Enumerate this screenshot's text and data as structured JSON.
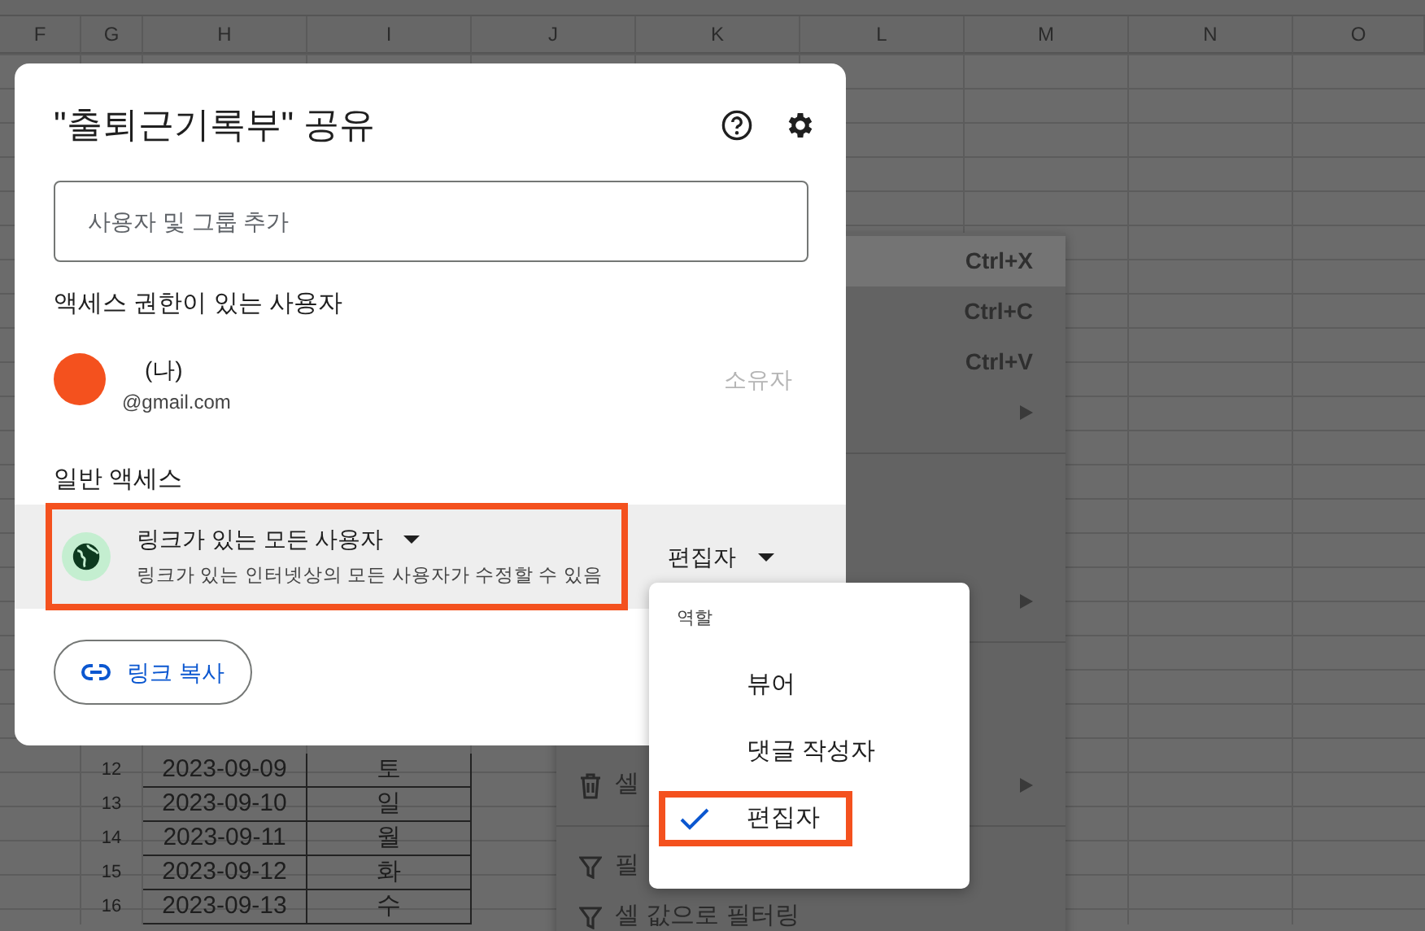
{
  "spreadsheet": {
    "columns": [
      "F",
      "G",
      "H",
      "I",
      "J",
      "K",
      "L",
      "M",
      "N",
      "O"
    ],
    "rows": [
      {
        "cells": [
          "",
          "12",
          "2023-09-09",
          "토"
        ]
      },
      {
        "cells": [
          "",
          "13",
          "2023-09-10",
          "일"
        ]
      },
      {
        "cells": [
          "",
          "14",
          "2023-09-11",
          "월"
        ]
      },
      {
        "cells": [
          "",
          "15",
          "2023-09-12",
          "화"
        ]
      },
      {
        "cells": [
          "",
          "16",
          "2023-09-13",
          "수"
        ]
      }
    ]
  },
  "context_menu": {
    "items": [
      {
        "kind": "shortcut",
        "text": "Ctrl+X",
        "selected": true
      },
      {
        "kind": "shortcut",
        "text": "Ctrl+C",
        "selected": false
      },
      {
        "kind": "shortcut",
        "text": "Ctrl+V",
        "selected": false
      },
      {
        "kind": "submenu",
        "selected": false
      },
      {
        "kind": "separator"
      },
      {
        "kind": "blank"
      },
      {
        "kind": "submenu",
        "selected": false
      },
      {
        "kind": "separator"
      },
      {
        "kind": "blank"
      },
      {
        "kind": "delete",
        "text": "셀",
        "selected": false
      },
      {
        "kind": "separator"
      },
      {
        "kind": "filter",
        "text": "필",
        "selected": false
      },
      {
        "kind": "filter",
        "text": "셀 값으로 필터링",
        "selected": false
      }
    ]
  },
  "dialog": {
    "title": "\"출퇴근기록부\" 공유",
    "add_field": {
      "placeholder": "사용자 및 그룹 추가"
    },
    "people_heading": "액세스 권한이 있는 사용자",
    "people": [
      {
        "name": "(나)",
        "email": "@gmail.com",
        "role": "소유자",
        "color": "#f4511e"
      }
    ],
    "general_heading": "일반 액세스",
    "general_access": {
      "scope": "링크가 있는 모든 사용자",
      "description": "링크가 있는 인터넷상의 모든 사용자가 수정할 수 있음",
      "role": "편집자",
      "highlighted": true
    },
    "copy_link": "링크 복사"
  },
  "role_menu": {
    "heading": "역할",
    "options": [
      {
        "label": "뷰어",
        "selected": false,
        "highlighted": false
      },
      {
        "label": "댓글 작성자",
        "selected": false,
        "highlighted": false
      },
      {
        "label": "편집자",
        "selected": true,
        "highlighted": true
      }
    ]
  }
}
